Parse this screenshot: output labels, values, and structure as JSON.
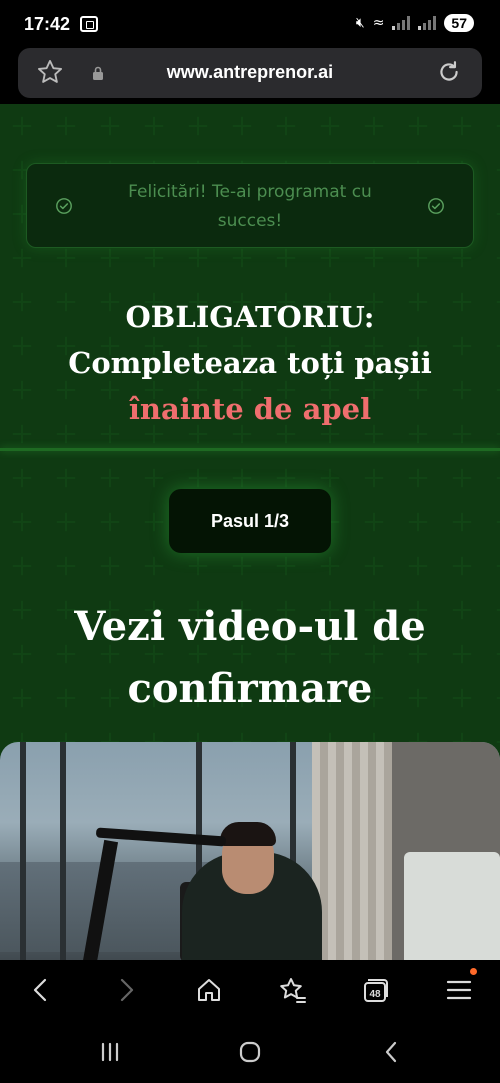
{
  "status_bar": {
    "time": "17:42",
    "battery": "57",
    "icons": [
      "screen-record-icon",
      "mute-icon",
      "wifi-icon",
      "signal-icon",
      "battery-icon"
    ]
  },
  "browser": {
    "url": "www.antreprenor.ai",
    "tab_count": "48",
    "icons": [
      "star-icon",
      "lock-icon",
      "reload-icon",
      "back-icon",
      "forward-icon",
      "home-icon",
      "bookmarks-icon",
      "tabs-icon",
      "menu-icon"
    ]
  },
  "page": {
    "success_message": "Felicitări! Te-ai programat cu succes!",
    "heading_line1": "OBLIGATORIU:",
    "heading_line2": "Completeaza toți pașii",
    "heading_accent": "înainte de apel",
    "step_label": "Pasul 1/3",
    "video_title": "Vezi video-ul de confirmare"
  },
  "colors": {
    "background": "#082108",
    "success_text": "#4c8e50",
    "accent_red": "#ef6e6e",
    "glow_green": "#1e6a22"
  }
}
